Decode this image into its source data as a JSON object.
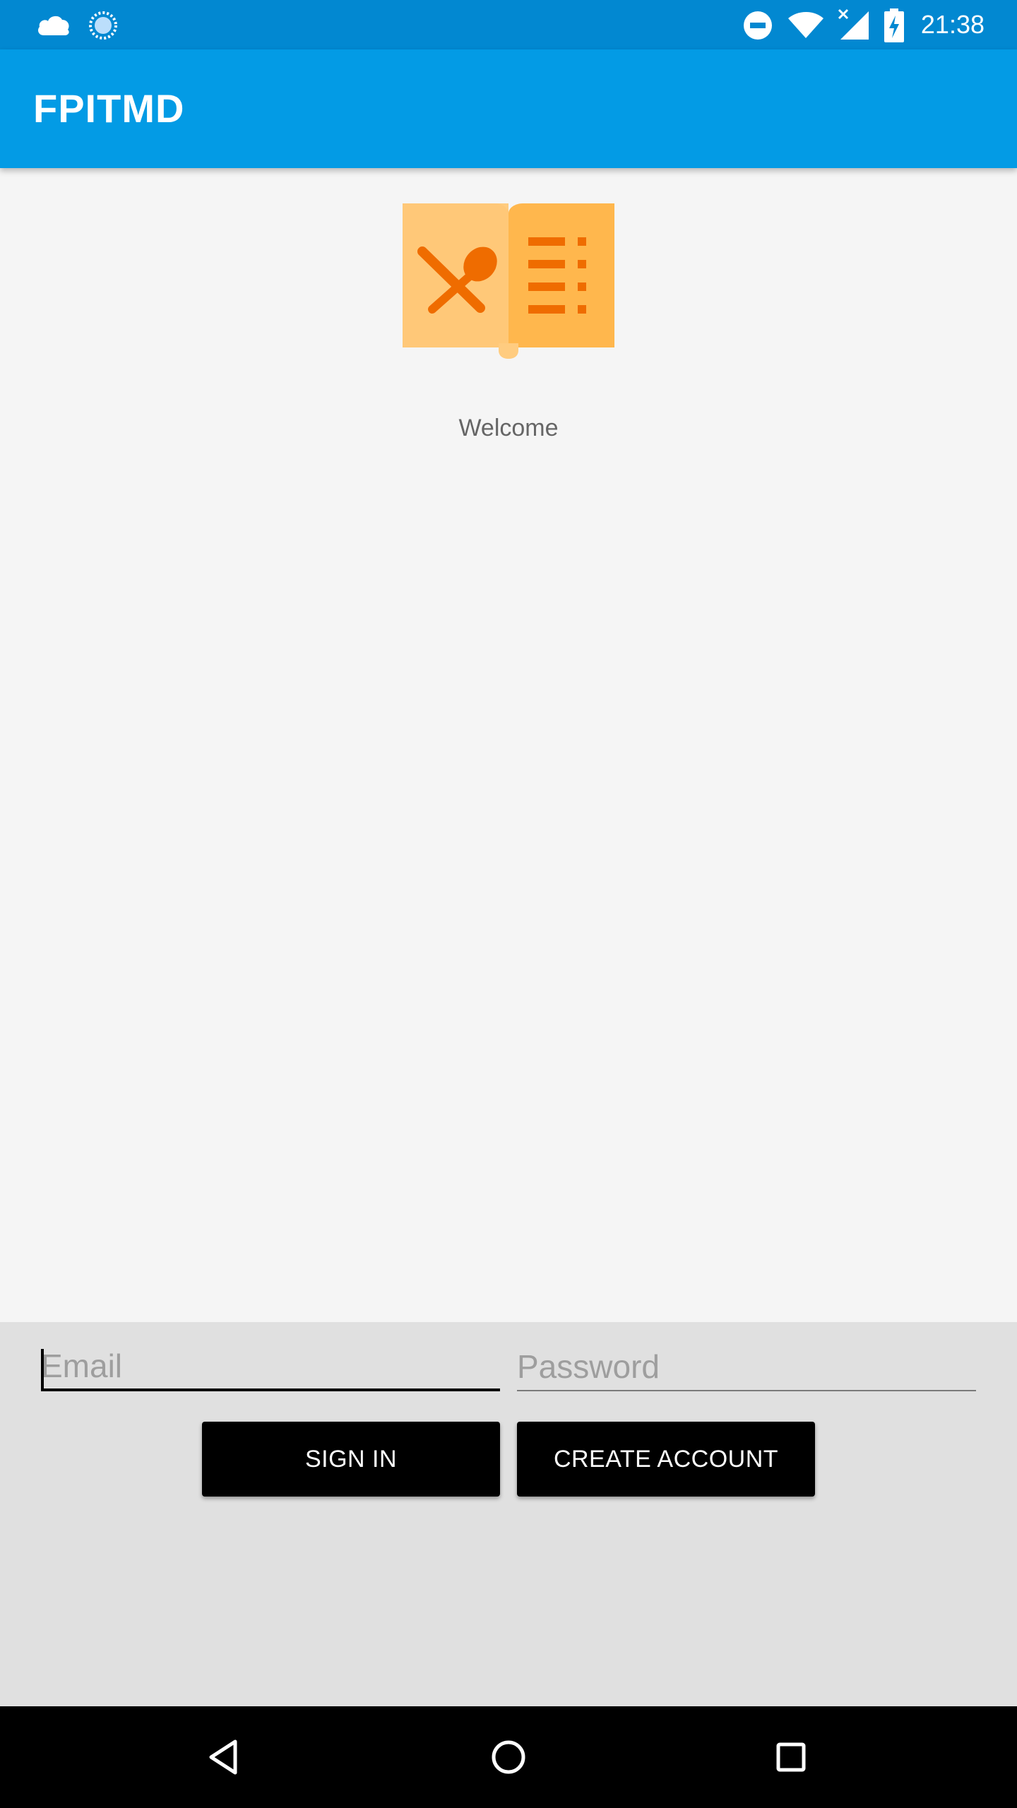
{
  "status_bar": {
    "time": "21:38",
    "left_icons": [
      "cloud-icon",
      "sync-progress-icon"
    ],
    "right_icons": [
      "do-not-disturb-icon",
      "wifi-icon",
      "cell-signal-no-data-icon",
      "battery-charging-icon"
    ],
    "background_color": "#0288d1"
  },
  "app_bar": {
    "title": "FPITMD",
    "background_color": "#039be5"
  },
  "content": {
    "logo_icon": "menu-book-icon",
    "welcome_text": "Welcome"
  },
  "login": {
    "email_placeholder": "Email",
    "email_value": "",
    "password_placeholder": "Password",
    "password_value": "",
    "sign_in_label": "SIGN IN",
    "create_account_label": "CREATE ACCOUNT"
  },
  "nav_bar": {
    "icons": [
      "back-icon",
      "home-icon",
      "recents-icon"
    ]
  }
}
